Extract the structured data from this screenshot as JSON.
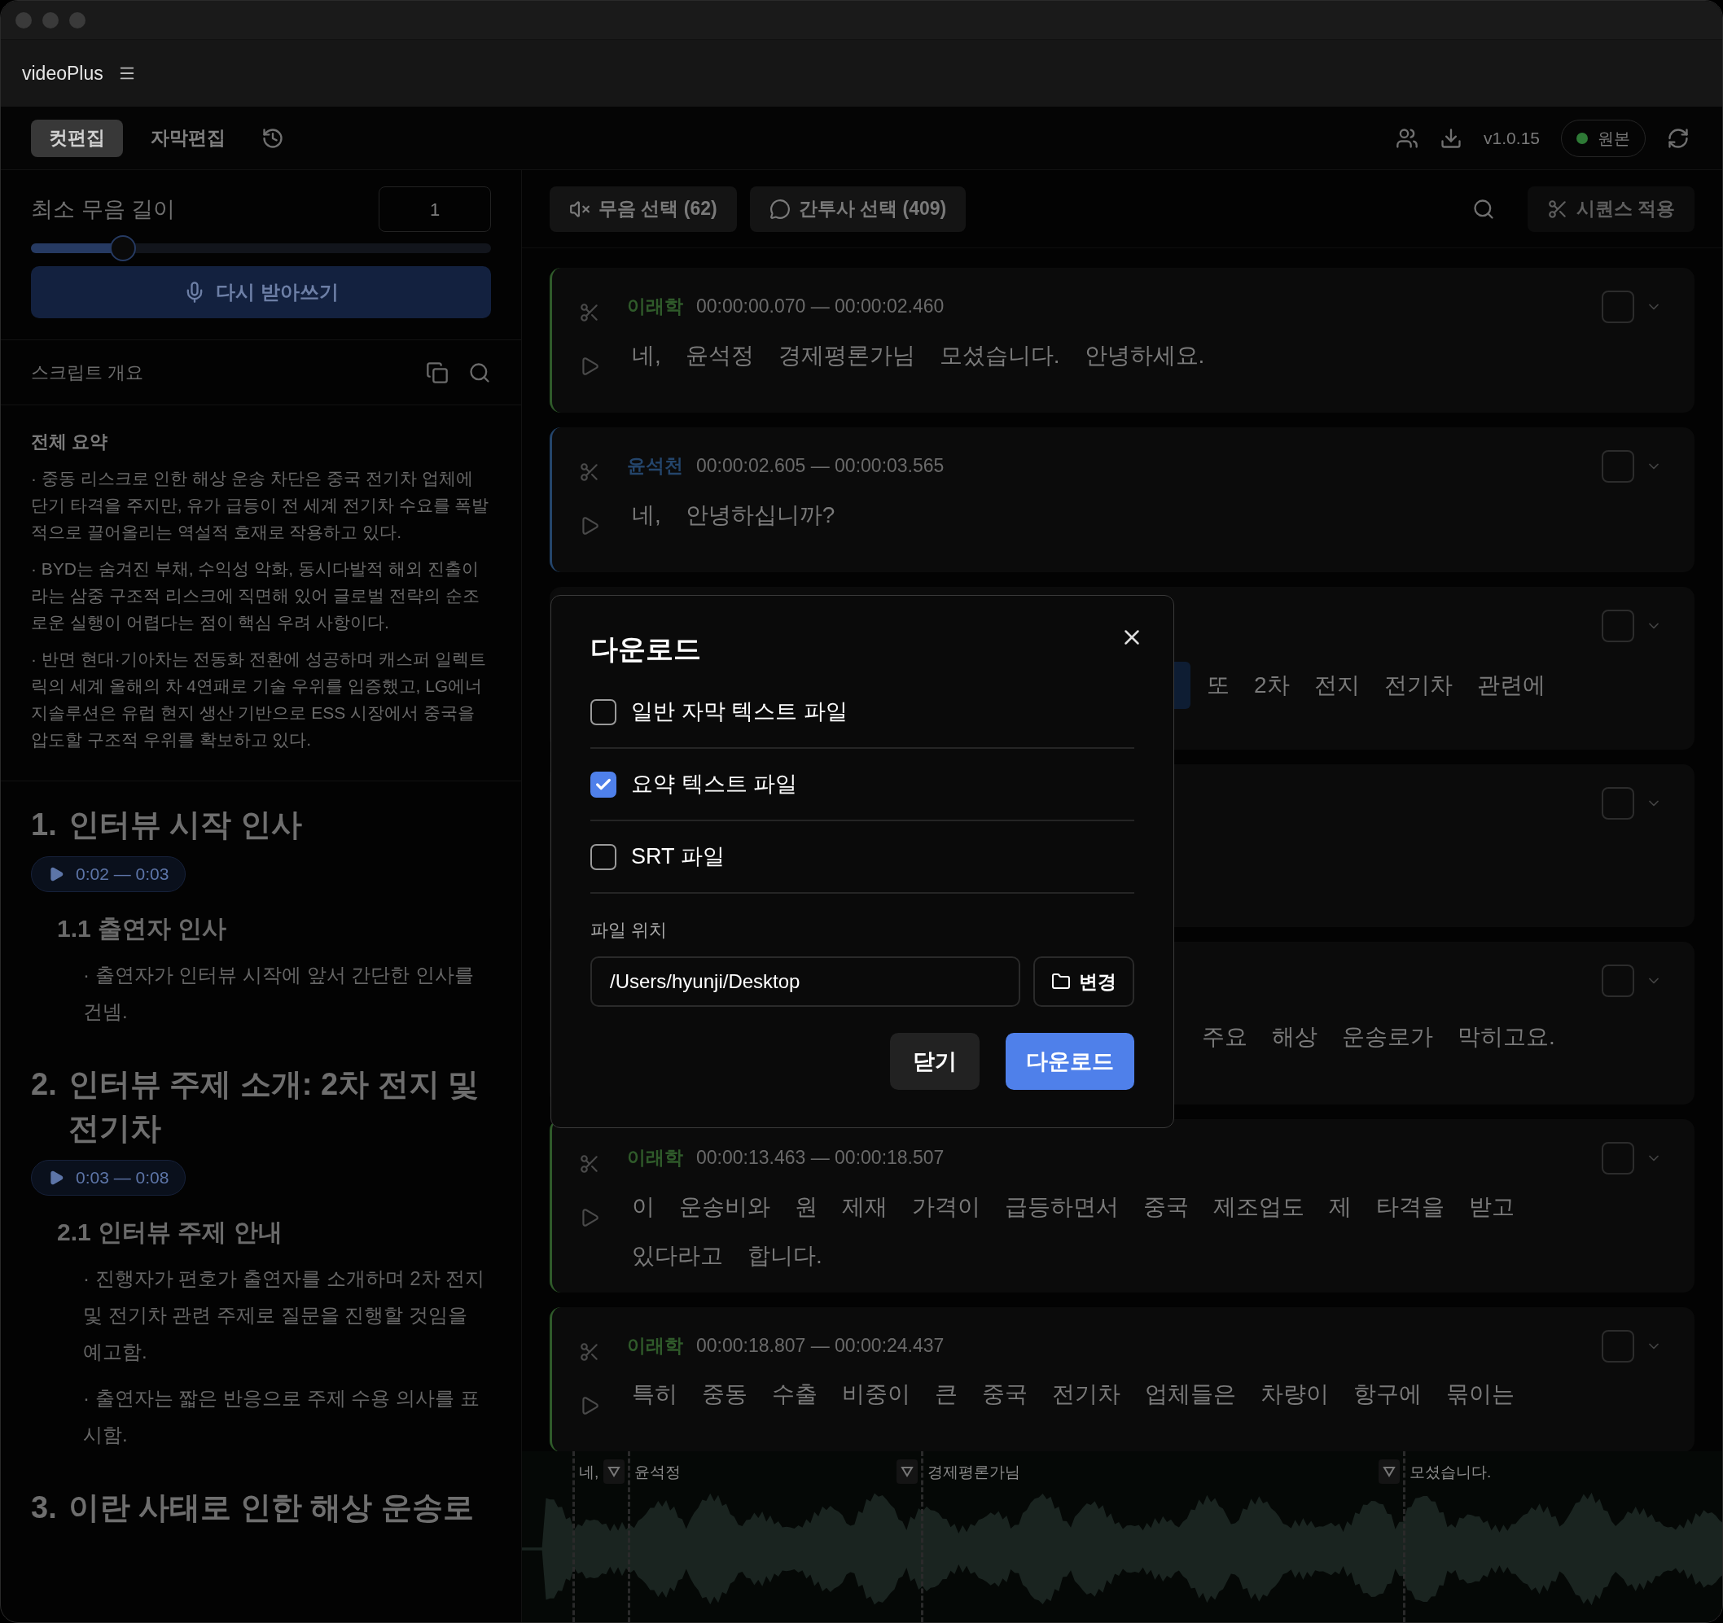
{
  "window": {
    "app_name": "videoPlus"
  },
  "toolbar": {
    "tabs": [
      {
        "label": "컷편집",
        "selected": true
      },
      {
        "label": "자막편집",
        "selected": false
      }
    ],
    "version": "v1.0.15",
    "status": "원본"
  },
  "left_panel": {
    "min_silence": {
      "label": "최소 무음 길이",
      "value": "1",
      "level": 0.2
    },
    "retranscribe_button": "다시 받아쓰기",
    "overview_title": "스크립트 개요",
    "summary": {
      "title": "전체 요약",
      "paragraphs": [
        "· 중동 리스크로 인한 해상 운송 차단은 중국 전기차 업체에 단기 타격을 주지만, 유가 급등이 전 세계 전기차 수요를 폭발적으로 끌어올리는 역설적 호재로 작용하고 있다.",
        "· BYD는 숨겨진 부채, 수익성 악화, 동시다발적 해외 진출이라는 삼중 구조적 리스크에 직면해 있어 글로벌 전략의 순조로운 실행이 어렵다는 점이 핵심 우려 사항이다.",
        "· 반면 현대·기아차는 전동화 전환에 성공하며 캐스퍼 일렉트릭의 세계 올해의 차 4연패로 기술 우위를 입증했고, LG에너지솔루션은 유럽 현지 생산 기반으로 ESS 시장에서 중국을 압도할 구조적 우위를 확보하고 있다."
      ]
    },
    "outline": [
      {
        "number": "1.",
        "title": "인터뷰 시작 인사",
        "time": "0:02 — 0:03",
        "children": [
          {
            "title": "1.1 출연자 인사",
            "points": [
              "· 출연자가 인터뷰 시작에 앞서 간단한 인사를 건넴."
            ]
          }
        ]
      },
      {
        "number": "2.",
        "title": "인터뷰 주제 소개: 2차 전지 및 전기차",
        "time": "0:03 — 0:08",
        "children": [
          {
            "title": "2.1 인터뷰 주제 안내",
            "points": [
              "· 진행자가 편호가 출연자를 소개하며 2차 전지 및 전기차 관련 주제로 질문을 진행할 것임을 예고함.",
              "· 출연자는 짧은 반응으로 주제 수용 의사를 표시함."
            ]
          }
        ]
      },
      {
        "number": "3.",
        "title": "이란 사태로 인한 해상 운송로"
      }
    ]
  },
  "editor": {
    "buttons": [
      {
        "kind": "silence",
        "label": "무음 선택 (62)"
      },
      {
        "kind": "filler",
        "label": "간투사 선택 (409)"
      }
    ],
    "apply_button": "시퀀스 적용",
    "segments": [
      {
        "kind": "full",
        "speaker": "이래학",
        "color": "#2f5a2a",
        "time": "00:00:00.070 — 00:00:02.460",
        "checked": false,
        "words": [
          "네,",
          "윤석정",
          "경제평론가님",
          "모셨습니다.",
          "안녕하세요."
        ]
      },
      {
        "kind": "full",
        "speaker": "윤석천",
        "color": "#24456b",
        "time": "00:00:02.605 — 00:00:03.565",
        "checked": false,
        "words": [
          "네,",
          "안녕하십니까?"
        ]
      },
      {
        "kind": "covered",
        "checked": false,
        "highlight": true,
        "words": [
          "또",
          "2차",
          "전지",
          "전기차",
          "관련에"
        ]
      },
      {
        "kind": "covered",
        "checked": false
      },
      {
        "kind": "covered",
        "checked": false,
        "words": [
          "주요",
          "해상",
          "운송로가",
          "막히고요."
        ]
      },
      {
        "kind": "full",
        "speaker": "이래학",
        "color": "#2f5a2a",
        "time": "00:00:13.463 — 00:00:18.507",
        "checked": false,
        "words": [
          "이",
          "운송비와",
          "원",
          "제재",
          "가격이",
          "급등하면서",
          "중국",
          "제조업도",
          "제",
          "타격을",
          "받고",
          "있다라고",
          "합니다."
        ]
      },
      {
        "kind": "full",
        "speaker": "이래학",
        "color": "#2f5a2a",
        "time": "00:00:18.807 — 00:00:24.437",
        "checked": false,
        "words": [
          "특히",
          "중동",
          "수출",
          "비중이",
          "큰",
          "중국",
          "전기차",
          "업체들은",
          "차량이",
          "항구에",
          "묶이는"
        ]
      }
    ]
  },
  "waveform": {
    "markers": [
      {
        "label": "네,"
      },
      {
        "label": "윤석정"
      },
      {
        "label": "경제평론가님"
      },
      {
        "label": "모셨습니다."
      }
    ]
  },
  "dialog": {
    "title": "다운로드",
    "options": [
      {
        "label": "일반 자막 텍스트 파일",
        "checked": false
      },
      {
        "label": "요약 텍스트 파일",
        "checked": true
      },
      {
        "label": "SRT 파일",
        "checked": false
      }
    ],
    "location_label": "파일 위치",
    "path": "/Users/hyunji/Desktop",
    "change_button": "변경",
    "cancel_button": "닫기",
    "confirm_button": "다운로드"
  }
}
